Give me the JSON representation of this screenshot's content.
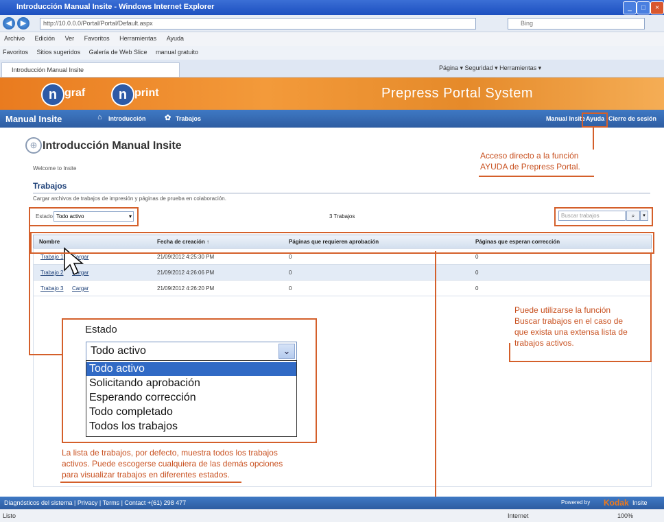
{
  "window": {
    "title": "Introducción Manual Insite - Windows Internet Explorer",
    "address": "http://10.0.0.0/Portal/Portal/Default.aspx",
    "search_placeholder": "Bing",
    "controls": {
      "minimize": "_",
      "maximize": "□",
      "close": "×"
    }
  },
  "menu": [
    "Archivo",
    "Edición",
    "Ver",
    "Favoritos",
    "Herramientas",
    "Ayuda"
  ],
  "favorites": [
    "Favoritos",
    "Sitios sugeridos",
    "Galería de Web Slice",
    "manual gratuito"
  ],
  "browser_tab": {
    "label": "Introducción Manual Insite"
  },
  "browser_tools": "Página ▾   Seguridad ▾   Herramientas ▾",
  "banner": {
    "logo1": "graf",
    "logo2": "print",
    "portal_title": "Prepress Portal System"
  },
  "nav": {
    "brand": "Manual Insite",
    "crumb_intro": "Introducción",
    "crumb_jobs": "Trabajos",
    "right_links": {
      "manual": "Manual Insite",
      "ayuda": "Ayuda",
      "logout": "Cierre de sesión"
    }
  },
  "page": {
    "title": "Introducción Manual Insite",
    "welcome": "Welcome to Insite",
    "section": "Trabajos",
    "section_desc": "Cargar archivos de trabajos de impresión y páginas de prueba en colaboración.",
    "estado_label": "Estado",
    "estado_value": "Todo activo",
    "jobs_count": "3 Trabajos",
    "search_placeholder": "Buscar trabajos"
  },
  "table": {
    "headers": [
      "Nombre",
      "Fecha de creación ↑",
      "Páginas que requieren aprobación",
      "Páginas que esperan corrección"
    ],
    "rows": [
      {
        "name": "Trabajo 1",
        "link": "Cargar",
        "date": "21/09/2012 4:25:30 PM",
        "approval": "0",
        "correction": "0"
      },
      {
        "name": "Trabajo 2",
        "link": "Cargar",
        "date": "21/09/2012 4:26:06 PM",
        "approval": "0",
        "correction": "0"
      },
      {
        "name": "Trabajo 3",
        "link": "Cargar",
        "date": "21/09/2012 4:26:20 PM",
        "approval": "0",
        "correction": "0"
      }
    ]
  },
  "dropdown_zoom": {
    "label": "Estado",
    "selected": "Todo activo",
    "options": [
      "Todo activo",
      "Solicitando aprobación",
      "Esperando corrección",
      "Todo completado",
      "Todos los trabajos"
    ]
  },
  "callouts": {
    "ayuda": [
      "Acceso directo a la función",
      "AYUDA de Prepress Portal."
    ],
    "buscar": [
      "Puede utilizarse la función",
      "Buscar trabajos en el caso de",
      "que exista una extensa lista de",
      "trabajos activos."
    ],
    "lista": [
      "La lista de trabajos, por defecto, muestra todos los trabajos",
      "activos. Puede escogerse cualquiera de las demás opciones",
      "para visualizar trabajos en diferentes estados."
    ]
  },
  "footer": {
    "left": "Diagnósticos del sistema  |  Privacy  |  Terms  |  Contact +(61) 298 477",
    "right_prefix": "Powered by",
    "right_brand": "Kodak",
    "right_suffix": "Insite"
  },
  "status": {
    "left": "Listo",
    "zone": "Internet",
    "zoom": "100%"
  },
  "colors": {
    "accent_orange": "#d45f2a",
    "nav_blue": "#2e5da2",
    "banner_orange": "#e97b1f"
  }
}
